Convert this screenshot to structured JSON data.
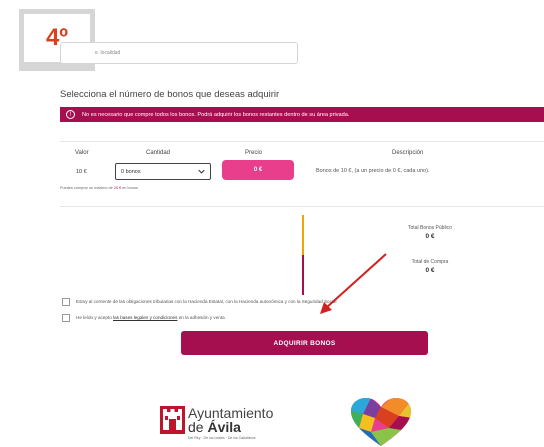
{
  "step": {
    "label": "4º"
  },
  "locality": {
    "placeholder": "e. localidad"
  },
  "heading": "Selecciona el número de bonos que deseas adquirir",
  "info_banner": {
    "icon": "info-circle-icon",
    "icon_glyph": "!",
    "text": "No es necesario que compre todos los bonos. Podrá adquirir los bonos restantes dentro de su área privada."
  },
  "bonos_table": {
    "headers": {
      "valor": "Valor",
      "cantidad": "Cantidad",
      "precio": "Precio",
      "descripcion": "Descripción"
    },
    "valor": "10 €",
    "cantidad_selected": "0 bonos",
    "precio": "0 €",
    "descripcion": "Bonos de 10 €, (a un precio de 0 €, cada uno).",
    "max_note_prefix": "Puedes comprar un máximo de",
    "max_note_amount": "20 €",
    "max_note_suffix": "en bonos"
  },
  "totals": {
    "publico_label": "Total Bonos Público",
    "publico_value": "0 €",
    "compra_label": "Total de Compra",
    "compra_value": "0 €"
  },
  "checkboxes": {
    "hacienda_label": "Estoy al corriente de las obligaciones tributarias con la Hacienda Estatal, con la Hacienda autonómica y con la Seguridad Social",
    "bases_prefix": "He leído y acepto",
    "bases_link": "las bases legales y condiciones",
    "bases_suffix": "en la adhesión y venta"
  },
  "submit_button": "ADQUIRIR BONOS",
  "footer": {
    "ayuntamiento_line1": "Ayuntamiento",
    "ayuntamiento_de": "de",
    "ayuntamiento_city": "Ávila",
    "ayuntamiento_motto": "Del Rey · De los Leales · De los Caballeros"
  },
  "colors": {
    "brand": "#a50e4f",
    "price_pink": "#e83e8c",
    "step_orange": "#d9401f",
    "total_publico_accent": "#f0a500"
  }
}
